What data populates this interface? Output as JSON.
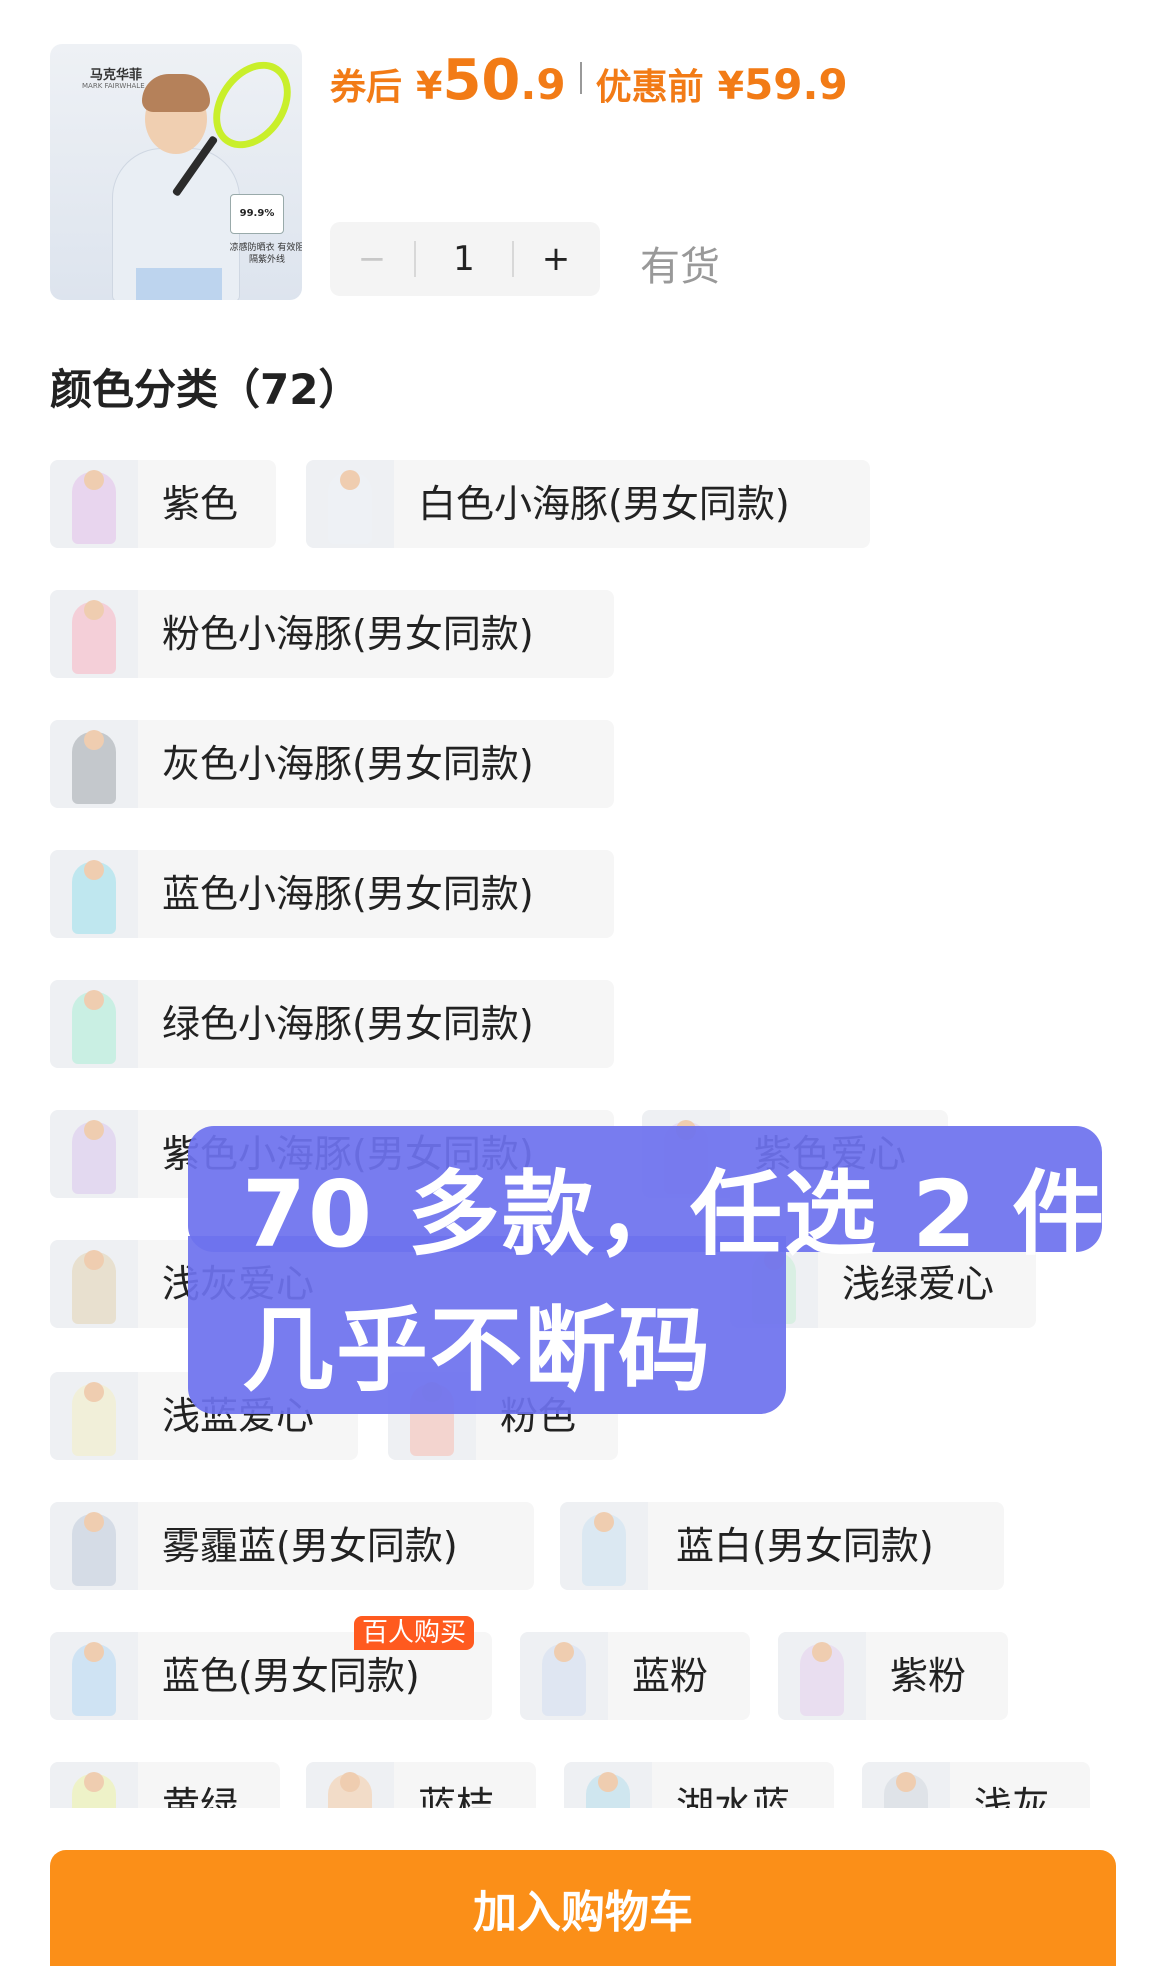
{
  "product": {
    "thumb_brand": "马克华菲",
    "thumb_brand_en": "MARK FAIRWHALE",
    "thumb_tag": "99.9%",
    "thumb_caption": "凉感防晒衣 有效阻隔紫外线"
  },
  "price": {
    "after_coupon_label": "券后",
    "after_coupon_symbol": "¥",
    "after_coupon_int": "50",
    "after_coupon_dec": ".9",
    "before_label": "优惠前",
    "before_symbol": "¥",
    "before_value": "59.9"
  },
  "quantity": {
    "minus": "−",
    "value": "1",
    "plus": "+",
    "stock": "有货"
  },
  "colors": {
    "title": "颜色分类（72）",
    "items": [
      {
        "label": "紫色",
        "tone": "#e8d5ee"
      },
      {
        "label": "白色小海豚(男女同款)",
        "tone": "#eef1f5"
      },
      {
        "label": "粉色小海豚(男女同款)",
        "tone": "#f4cfd8"
      },
      {
        "label": "灰色小海豚(男女同款)",
        "tone": "#c4c8cc"
      },
      {
        "label": "蓝色小海豚(男女同款)",
        "tone": "#bfe7ef"
      },
      {
        "label": "绿色小海豚(男女同款)",
        "tone": "#c9efe3"
      },
      {
        "label": "紫色小海豚(男女同款)",
        "tone": "#e3d9f0"
      },
      {
        "label": "紫色爱心",
        "tone": "#e7ddf0"
      },
      {
        "label": "浅灰爱心",
        "tone": "#e8e0cf"
      },
      {
        "label": "浅绿爱心",
        "tone": "#d9efe3"
      },
      {
        "label": "浅蓝爱心",
        "tone": "#f1efd9"
      },
      {
        "label": "粉色",
        "tone": "#f3d4cf"
      },
      {
        "label": "雾霾蓝(男女同款)",
        "tone": "#d5dce6"
      },
      {
        "label": "蓝白(男女同款)",
        "tone": "#dbe8f2"
      },
      {
        "label": "蓝色(男女同款)",
        "tone": "#cfe3f3",
        "tag": "百人购买"
      },
      {
        "label": "蓝粉",
        "tone": "#dfe6f2"
      },
      {
        "label": "紫粉",
        "tone": "#e9def0"
      },
      {
        "label": "黄绿",
        "tone": "#eef2c8"
      },
      {
        "label": "蓝桔",
        "tone": "#f2dcc8"
      },
      {
        "label": "湖水蓝",
        "tone": "#cfe6ef"
      },
      {
        "label": "浅灰",
        "tone": "#dfe3e8"
      }
    ]
  },
  "overlay": {
    "line1": "70 多款，任选 2 件",
    "line2": "几乎不断码"
  },
  "cart": {
    "label": "加入购物车"
  },
  "colors_theme": {
    "accent": "#fb8f18",
    "price": "#f27b16",
    "overlay": "#6e72ee",
    "tag": "#ff5a1f"
  }
}
